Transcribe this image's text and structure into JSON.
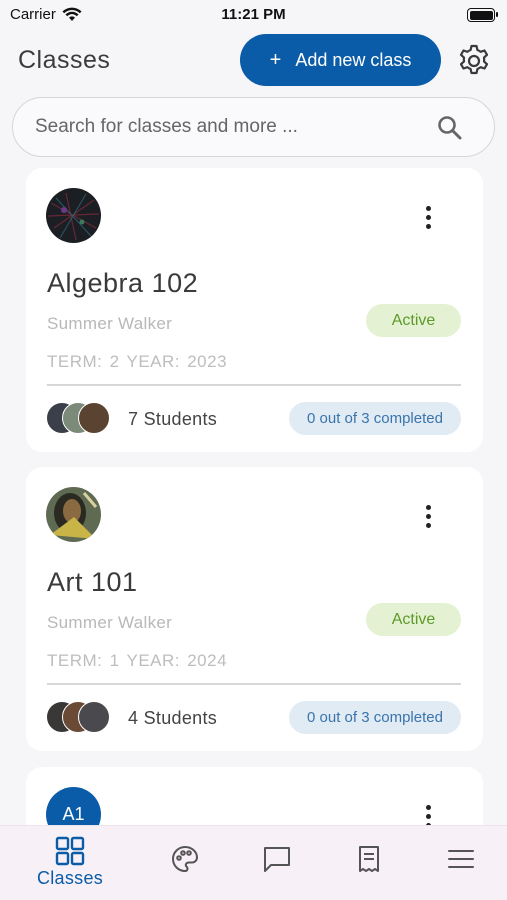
{
  "status_bar": {
    "carrier": "Carrier",
    "time": "11:21 PM"
  },
  "header": {
    "title": "Classes",
    "add_button_label": "Add new class",
    "add_button_plus": "+"
  },
  "search": {
    "placeholder": "Search for classes and more ..."
  },
  "classes": [
    {
      "name": "Algebra 102",
      "teacher": "Summer Walker",
      "status": "Active",
      "term": "TERM: 2  YEAR: 2023",
      "students": "7 Students",
      "completed": "0 out of 3 completed"
    },
    {
      "name": "Art 101",
      "teacher": "Summer Walker",
      "status": "Active",
      "term": "TERM: 1  YEAR: 2024",
      "students": "4 Students",
      "completed": "0 out of 3 completed"
    },
    {
      "avatar_initials": "A1"
    }
  ],
  "tabbar": {
    "active_label": "Classes",
    "items": [
      "classes-icon",
      "palette-icon",
      "chat-bubble-icon",
      "receipt-icon",
      "menu-icon"
    ]
  },
  "colors": {
    "primary": "#0a5ca8",
    "active_bg": "#e4f2d3",
    "active_text": "#5e9a2a",
    "completed_bg": "#e1ebf4",
    "completed_text": "#3a74ac",
    "background": "#f6f6f8"
  }
}
